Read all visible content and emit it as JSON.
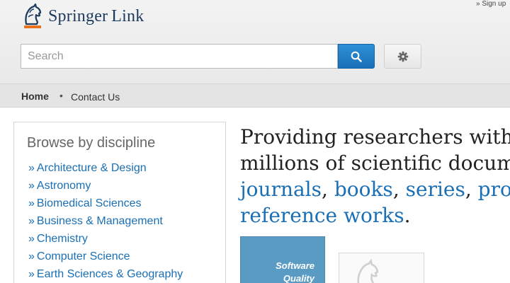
{
  "header": {
    "signup_text": "» Sign up",
    "logo": {
      "brand": "Springer",
      "product": "Link",
      "icon": "springer-horse-logo"
    },
    "search": {
      "placeholder": "Search",
      "value": "",
      "button_icon": "search-icon"
    },
    "settings_icon": "gear-icon"
  },
  "nav": {
    "items": [
      {
        "label": "Home"
      },
      {
        "label": "Contact Us"
      }
    ],
    "separator": "•"
  },
  "browse": {
    "title": "Browse by discipline",
    "items": [
      {
        "label": "Architecture & Design"
      },
      {
        "label": "Astronomy"
      },
      {
        "label": "Biomedical Sciences"
      },
      {
        "label": "Business & Management"
      },
      {
        "label": "Chemistry"
      },
      {
        "label": "Computer Science"
      },
      {
        "label": "Earth Sciences & Geography"
      }
    ]
  },
  "headline": {
    "line1": "Providing researchers with a",
    "line2": "millions of scientific docum",
    "journals": "journals",
    "books": "books",
    "series": "series",
    "protocols": "prot",
    "reference": "reference works",
    "comma": ",",
    "period": "."
  },
  "covers": [
    {
      "title_line1": "Software",
      "title_line2": "Quality"
    }
  ],
  "colors": {
    "accent_blue": "#1a6fb5",
    "search_button": "#1a71b8",
    "logo_navy": "#1c3a5e",
    "logo_orange": "#e8731f"
  }
}
